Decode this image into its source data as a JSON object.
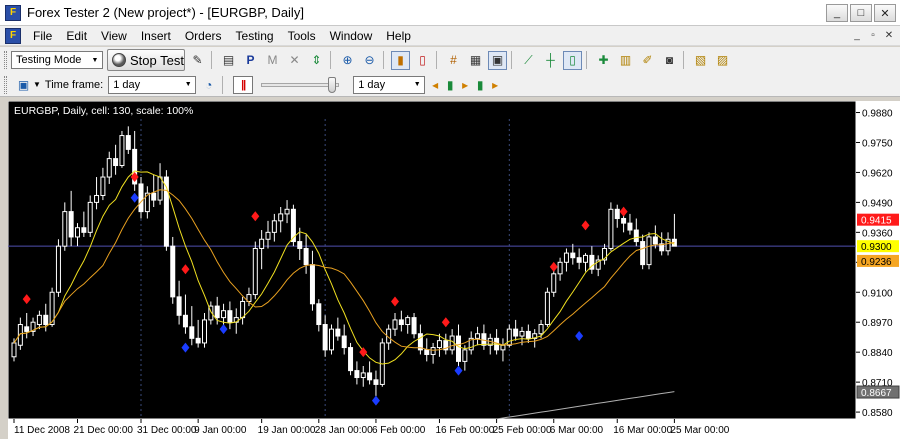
{
  "window": {
    "title": "Forex Tester 2  (New project*) - [EURGBP, Daily]",
    "app_icon": "F",
    "buttons": {
      "minimize": "_",
      "maximize": "□",
      "close": "✕"
    }
  },
  "menu": {
    "items": [
      "File",
      "Edit",
      "View",
      "Insert",
      "Orders",
      "Testing",
      "Tools",
      "Window",
      "Help"
    ],
    "mdi": {
      "minimize": "_",
      "restore": "▫",
      "close": "✕"
    }
  },
  "toolbar1": {
    "mode_selected": "Testing Mode",
    "stop_test_label": "Stop Test",
    "icons": [
      "edit-icon",
      "new-order-icon",
      "pending-order-icon",
      "modify-order-icon",
      "close-order-icon",
      "market-order-icon",
      "zoom-in-icon",
      "zoom-out-icon",
      "bar-chart-icon",
      "candle-chart-icon",
      "grid-icon",
      "volume-icon",
      "shift-icon",
      "line-chart-icon",
      "bar-line-icon",
      "candle-line-icon",
      "indicator-add-icon",
      "template-icon",
      "brush-icon",
      "camera-icon",
      "export-icon",
      "data-icon"
    ]
  },
  "toolbar2": {
    "timeframe_label": "Time frame:",
    "timeframe_selected": "1 day",
    "speed_timeframe_selected": "1 day",
    "speed_slider_position": 0.95
  },
  "colors": {
    "chart_bg": "#000000",
    "candle": "#ffffff",
    "ma_fast": "#f0e020",
    "ma_slow": "#e8a020",
    "ma_long": "#b0b0b0",
    "marker_up": "#ff1a1a",
    "marker_down": "#1a3cff",
    "price_line": "#5050b0",
    "grid_vline": "#3a4a7a",
    "badge_red": "#ff1a1a",
    "badge_yellow": "#ffff00",
    "badge_orange": "#f5a623",
    "badge_gray": "#707070"
  },
  "chart_data": {
    "type": "candlestick",
    "title": "EURGBP, Daily, cell: 130, scale: 100%",
    "ylim": [
      0.855,
      0.993
    ],
    "y_ticks": [
      "0.9880",
      "0.9750",
      "0.9620",
      "0.9490",
      "0.9360",
      "0.9230",
      "0.9100",
      "0.8970",
      "0.8840",
      "0.8710",
      "0.8580"
    ],
    "x_tick_labels": [
      "11 Dec 2008",
      "21 Dec 00:00",
      "31 Dec 00:00",
      "9 Jan 00:00",
      "19 Jan 00:00",
      "28 Jan 00:00",
      "6 Feb 00:00",
      "16 Feb 00:00",
      "25 Feb 00:00",
      "6 Mar 00:00",
      "16 Mar 00:00",
      "25 Mar 00:00"
    ],
    "x_tick_index": [
      0,
      10,
      20,
      29,
      39,
      48,
      57,
      67,
      76,
      85,
      95,
      104
    ],
    "vertical_lines_at_index": [
      20,
      49,
      78
    ],
    "price_badges": [
      {
        "text": "0.9415",
        "value": 0.9415,
        "color": "red"
      },
      {
        "text": "0.9300",
        "value": 0.93,
        "color": "yellow"
      },
      {
        "text": "0.9236",
        "value": 0.9236,
        "color": "orange"
      },
      {
        "text": "0.8667",
        "value": 0.8667,
        "color": "gray"
      }
    ],
    "current_price": 0.93,
    "candles": [
      [
        0.882,
        0.89,
        0.88,
        0.888
      ],
      [
        0.887,
        0.899,
        0.885,
        0.896
      ],
      [
        0.895,
        0.901,
        0.89,
        0.893
      ],
      [
        0.893,
        0.899,
        0.891,
        0.897
      ],
      [
        0.896,
        0.902,
        0.894,
        0.9
      ],
      [
        0.9,
        0.905,
        0.893,
        0.896
      ],
      [
        0.896,
        0.912,
        0.895,
        0.91
      ],
      [
        0.91,
        0.933,
        0.908,
        0.93
      ],
      [
        0.93,
        0.949,
        0.928,
        0.945
      ],
      [
        0.945,
        0.954,
        0.93,
        0.934
      ],
      [
        0.934,
        0.94,
        0.93,
        0.938
      ],
      [
        0.938,
        0.945,
        0.934,
        0.936
      ],
      [
        0.936,
        0.952,
        0.934,
        0.949
      ],
      [
        0.949,
        0.96,
        0.946,
        0.952
      ],
      [
        0.952,
        0.964,
        0.95,
        0.96
      ],
      [
        0.96,
        0.971,
        0.957,
        0.968
      ],
      [
        0.968,
        0.974,
        0.961,
        0.965
      ],
      [
        0.965,
        0.98,
        0.964,
        0.978
      ],
      [
        0.978,
        0.982,
        0.97,
        0.972
      ],
      [
        0.972,
        0.98,
        0.954,
        0.957
      ],
      [
        0.957,
        0.96,
        0.942,
        0.945
      ],
      [
        0.945,
        0.956,
        0.942,
        0.953
      ],
      [
        0.953,
        0.961,
        0.947,
        0.95
      ],
      [
        0.95,
        0.966,
        0.948,
        0.96
      ],
      [
        0.96,
        0.963,
        0.928,
        0.93
      ],
      [
        0.93,
        0.934,
        0.905,
        0.908
      ],
      [
        0.908,
        0.915,
        0.896,
        0.9
      ],
      [
        0.9,
        0.909,
        0.892,
        0.895
      ],
      [
        0.895,
        0.904,
        0.887,
        0.89
      ],
      [
        0.89,
        0.898,
        0.886,
        0.888
      ],
      [
        0.888,
        0.901,
        0.886,
        0.898
      ],
      [
        0.898,
        0.906,
        0.896,
        0.904
      ],
      [
        0.904,
        0.908,
        0.896,
        0.899
      ],
      [
        0.899,
        0.905,
        0.895,
        0.902
      ],
      [
        0.902,
        0.906,
        0.894,
        0.897
      ],
      [
        0.897,
        0.903,
        0.892,
        0.899
      ],
      [
        0.899,
        0.908,
        0.896,
        0.906
      ],
      [
        0.906,
        0.912,
        0.904,
        0.909
      ],
      [
        0.909,
        0.932,
        0.907,
        0.929
      ],
      [
        0.929,
        0.937,
        0.92,
        0.933
      ],
      [
        0.933,
        0.941,
        0.929,
        0.936
      ],
      [
        0.936,
        0.944,
        0.932,
        0.941
      ],
      [
        0.941,
        0.947,
        0.936,
        0.944
      ],
      [
        0.944,
        0.95,
        0.94,
        0.946
      ],
      [
        0.946,
        0.948,
        0.93,
        0.932
      ],
      [
        0.932,
        0.938,
        0.924,
        0.929
      ],
      [
        0.929,
        0.935,
        0.918,
        0.922
      ],
      [
        0.922,
        0.928,
        0.902,
        0.905
      ],
      [
        0.905,
        0.907,
        0.893,
        0.896
      ],
      [
        0.896,
        0.9,
        0.882,
        0.885
      ],
      [
        0.885,
        0.896,
        0.883,
        0.894
      ],
      [
        0.894,
        0.899,
        0.889,
        0.891
      ],
      [
        0.891,
        0.896,
        0.883,
        0.886
      ],
      [
        0.886,
        0.888,
        0.874,
        0.876
      ],
      [
        0.876,
        0.88,
        0.87,
        0.873
      ],
      [
        0.873,
        0.878,
        0.869,
        0.875
      ],
      [
        0.875,
        0.88,
        0.87,
        0.872
      ],
      [
        0.872,
        0.876,
        0.865,
        0.87
      ],
      [
        0.87,
        0.89,
        0.869,
        0.888
      ],
      [
        0.888,
        0.896,
        0.885,
        0.894
      ],
      [
        0.894,
        0.901,
        0.891,
        0.898
      ],
      [
        0.898,
        0.902,
        0.893,
        0.896
      ],
      [
        0.896,
        0.9,
        0.892,
        0.899
      ],
      [
        0.899,
        0.901,
        0.89,
        0.892
      ],
      [
        0.892,
        0.896,
        0.883,
        0.885
      ],
      [
        0.885,
        0.89,
        0.88,
        0.883
      ],
      [
        0.883,
        0.888,
        0.879,
        0.886
      ],
      [
        0.886,
        0.892,
        0.882,
        0.889
      ],
      [
        0.889,
        0.892,
        0.883,
        0.885
      ],
      [
        0.885,
        0.894,
        0.883,
        0.891
      ],
      [
        0.891,
        0.896,
        0.878,
        0.88
      ],
      [
        0.88,
        0.887,
        0.876,
        0.885
      ],
      [
        0.885,
        0.893,
        0.883,
        0.89
      ],
      [
        0.89,
        0.895,
        0.887,
        0.892
      ],
      [
        0.892,
        0.896,
        0.885,
        0.887
      ],
      [
        0.887,
        0.892,
        0.883,
        0.89
      ],
      [
        0.89,
        0.894,
        0.883,
        0.885
      ],
      [
        0.885,
        0.89,
        0.88,
        0.887
      ],
      [
        0.887,
        0.896,
        0.886,
        0.894
      ],
      [
        0.894,
        0.898,
        0.889,
        0.891
      ],
      [
        0.891,
        0.895,
        0.887,
        0.893
      ],
      [
        0.893,
        0.896,
        0.888,
        0.89
      ],
      [
        0.89,
        0.894,
        0.886,
        0.892
      ],
      [
        0.892,
        0.898,
        0.89,
        0.896
      ],
      [
        0.896,
        0.912,
        0.895,
        0.91
      ],
      [
        0.91,
        0.92,
        0.908,
        0.918
      ],
      [
        0.918,
        0.925,
        0.915,
        0.923
      ],
      [
        0.923,
        0.929,
        0.919,
        0.927
      ],
      [
        0.927,
        0.931,
        0.922,
        0.925
      ],
      [
        0.925,
        0.929,
        0.92,
        0.923
      ],
      [
        0.923,
        0.927,
        0.919,
        0.926
      ],
      [
        0.926,
        0.93,
        0.918,
        0.92
      ],
      [
        0.92,
        0.926,
        0.917,
        0.924
      ],
      [
        0.924,
        0.931,
        0.922,
        0.929
      ],
      [
        0.929,
        0.949,
        0.928,
        0.946
      ],
      [
        0.946,
        0.948,
        0.938,
        0.942
      ],
      [
        0.942,
        0.946,
        0.936,
        0.94
      ],
      [
        0.94,
        0.944,
        0.935,
        0.937
      ],
      [
        0.937,
        0.942,
        0.93,
        0.932
      ],
      [
        0.932,
        0.935,
        0.92,
        0.922
      ],
      [
        0.922,
        0.936,
        0.92,
        0.934
      ],
      [
        0.934,
        0.939,
        0.929,
        0.931
      ],
      [
        0.931,
        0.936,
        0.926,
        0.928
      ],
      [
        0.928,
        0.936,
        0.926,
        0.933
      ],
      [
        0.933,
        0.944,
        0.931,
        0.93
      ]
    ],
    "buy_markers": [
      [
        2,
        0.907
      ],
      [
        19,
        0.96
      ],
      [
        27,
        0.92
      ],
      [
        38,
        0.943
      ],
      [
        60,
        0.906
      ],
      [
        55,
        0.884
      ],
      [
        68,
        0.897
      ],
      [
        85,
        0.921
      ],
      [
        90,
        0.939
      ],
      [
        96,
        0.945
      ]
    ],
    "sell_markers": [
      [
        19,
        0.951
      ],
      [
        27,
        0.886
      ],
      [
        33,
        0.894
      ],
      [
        57,
        0.863
      ],
      [
        70,
        0.876
      ],
      [
        89,
        0.891
      ]
    ]
  }
}
